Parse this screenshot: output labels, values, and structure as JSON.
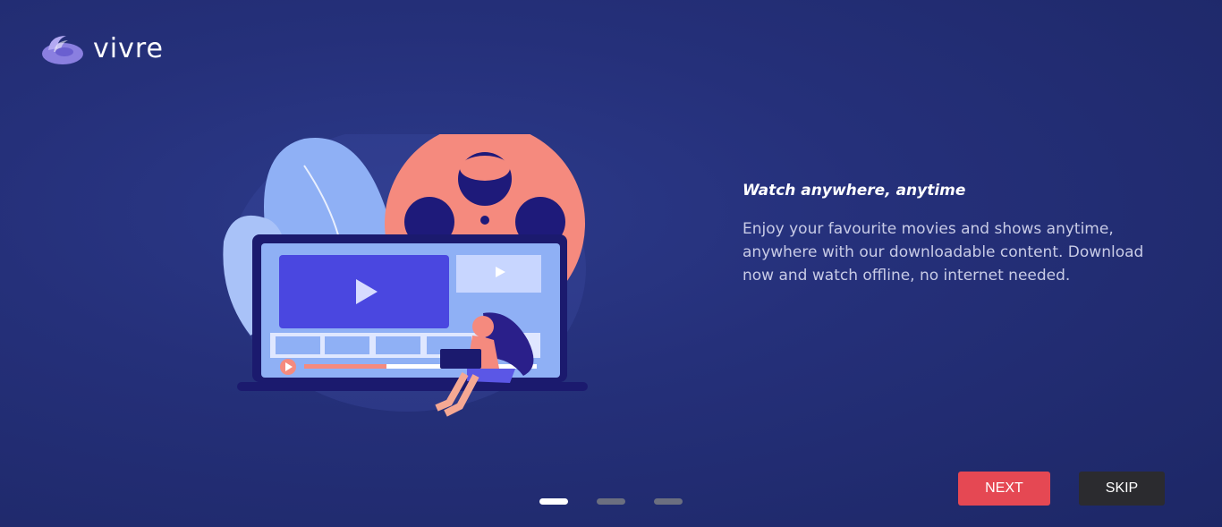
{
  "brand": {
    "name": "vivre",
    "logo_icon": "swirl-logo-icon"
  },
  "slide": {
    "headline": "Watch anywhere, anytime",
    "body": "Enjoy your favourite movies and shows anytime, anywhere with our downloadable content. Download now and watch offline, no internet needed.",
    "illustration_icon": "laptop-film-reel-illustration"
  },
  "pagination": {
    "total": 3,
    "active_index": 0
  },
  "buttons": {
    "next_label": "NEXT",
    "skip_label": "SKIP"
  },
  "colors": {
    "accent": "#e54853",
    "skip": "#2b2b2f",
    "background": "#25307a"
  }
}
